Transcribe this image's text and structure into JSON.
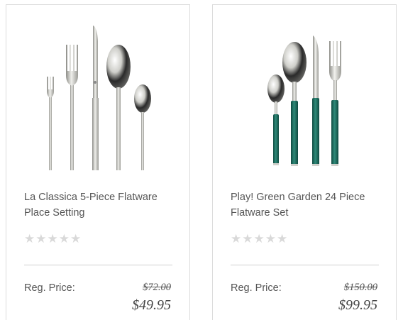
{
  "products": [
    {
      "name": "La Classica 5-Piece Flatware Place Setting",
      "image_alt": "silver-flatware-set-image",
      "rating": 0,
      "stars": "★★★★★",
      "reg_label": "Reg. Price:",
      "reg_price": "$72.00",
      "sale_price": "$49.95"
    },
    {
      "name": "Play! Green Garden 24 Piece Flatware Set",
      "image_alt": "green-handle-flatware-set-image",
      "rating": 0,
      "stars": "★★★★★",
      "reg_label": "Reg. Price:",
      "reg_price": "$150.00",
      "sale_price": "$99.95"
    }
  ],
  "colors": {
    "card_border": "#dcdcdc",
    "text": "#555555",
    "star_empty": "#d9d9d9",
    "handle_green": "#1f6b5e",
    "steel": "#c9c9c4"
  }
}
